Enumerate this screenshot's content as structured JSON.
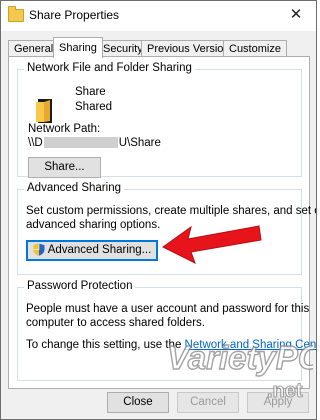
{
  "window": {
    "title": "Share Properties",
    "close_glyph": "✕"
  },
  "tabs": [
    {
      "label": "General"
    },
    {
      "label": "Sharing"
    },
    {
      "label": "Security"
    },
    {
      "label": "Previous Versions"
    },
    {
      "label": "Customize"
    }
  ],
  "network_sharing": {
    "legend": "Network File and Folder Sharing",
    "folder_name": "Share",
    "status": "Shared",
    "path_label": "Network Path:",
    "path_start": "\\\\D",
    "path_end": "U\\Share",
    "share_button": "Share..."
  },
  "advanced_sharing": {
    "legend": "Advanced Sharing",
    "description_line1": "Set custom permissions, create multiple shares, and set other",
    "description_line2": "advanced sharing options.",
    "button": "Advanced Sharing..."
  },
  "password_protection": {
    "legend": "Password Protection",
    "line1": "People must have a user account and password for this",
    "line2": "computer to access shared folders.",
    "change_prefix": "To change this setting, use the ",
    "link": "Network and Sharing Center",
    "change_suffix": "."
  },
  "footer": {
    "close": "Close",
    "cancel": "Cancel",
    "apply": "Apply"
  },
  "watermark": {
    "text": "VarietyPC",
    "suffix": ".net"
  },
  "colors": {
    "accent": "#0078d7",
    "arrow": "#e8141b",
    "link": "#0066cc"
  }
}
